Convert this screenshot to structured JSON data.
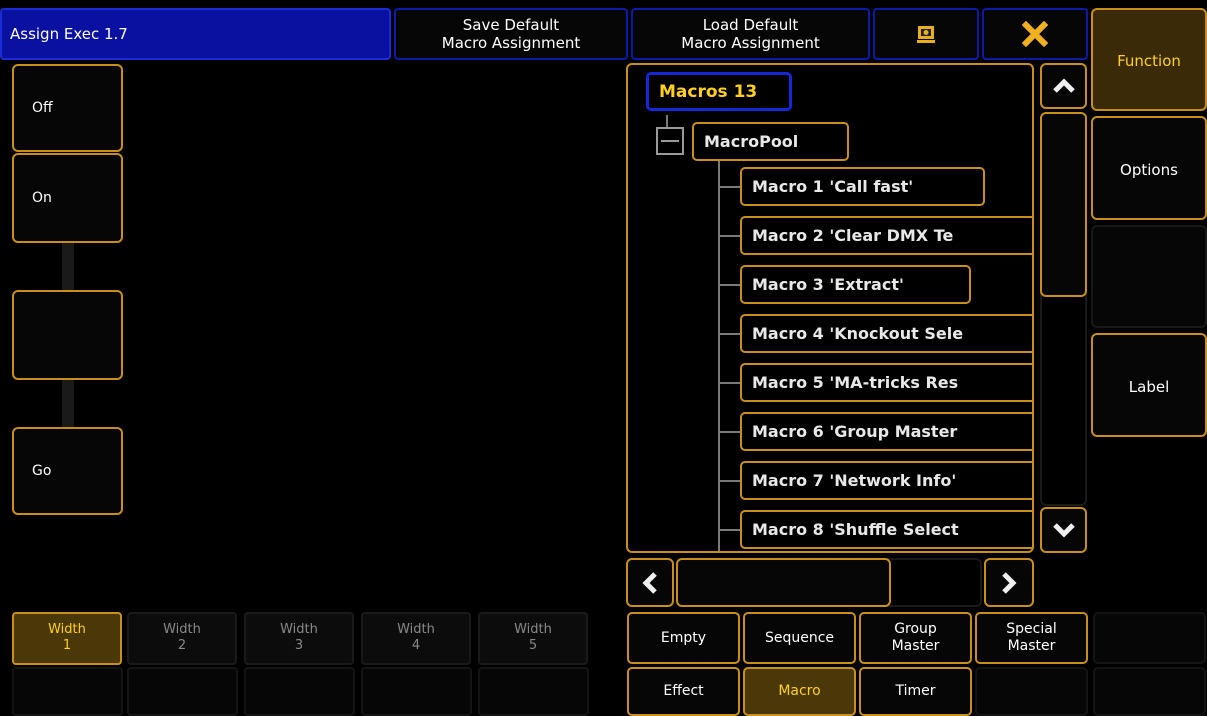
{
  "header": {
    "title": "Assign Exec 1.7",
    "save_default": "Save Default\nMacro Assignment",
    "load_default": "Load Default\nMacro Assignment"
  },
  "side_menu": [
    "Function",
    "Options",
    "",
    "Label"
  ],
  "controls": {
    "off": "Off",
    "on": "On",
    "middle": "",
    "go": "Go"
  },
  "width_tabs": [
    {
      "label": "Width",
      "value": "1"
    },
    {
      "label": "Width",
      "value": "2"
    },
    {
      "label": "Width",
      "value": "3"
    },
    {
      "label": "Width",
      "value": "4"
    },
    {
      "label": "Width",
      "value": "5"
    }
  ],
  "tree": {
    "root": "Macros 13",
    "pool": "MacroPool",
    "items": [
      "Macro 1 'Call fast'",
      "Macro 2 'Clear DMX Te",
      "Macro 3 'Extract'",
      "Macro 4 'Knockout Sele",
      "Macro 5 'MA-tricks Res",
      "Macro 6 'Group Master",
      "Macro 7 'Network Info'",
      "Macro 8 'Shuffle Select"
    ]
  },
  "functions": {
    "empty": "Empty",
    "sequence": "Sequence",
    "group_master": "Group\nMaster",
    "special_master": "Special\nMaster",
    "effect": "Effect",
    "macro": "Macro",
    "timer": "Timer"
  },
  "colors": {
    "accent": "#c8901a",
    "title_blue": "#0a10a0",
    "active_text": "#ffd020"
  }
}
